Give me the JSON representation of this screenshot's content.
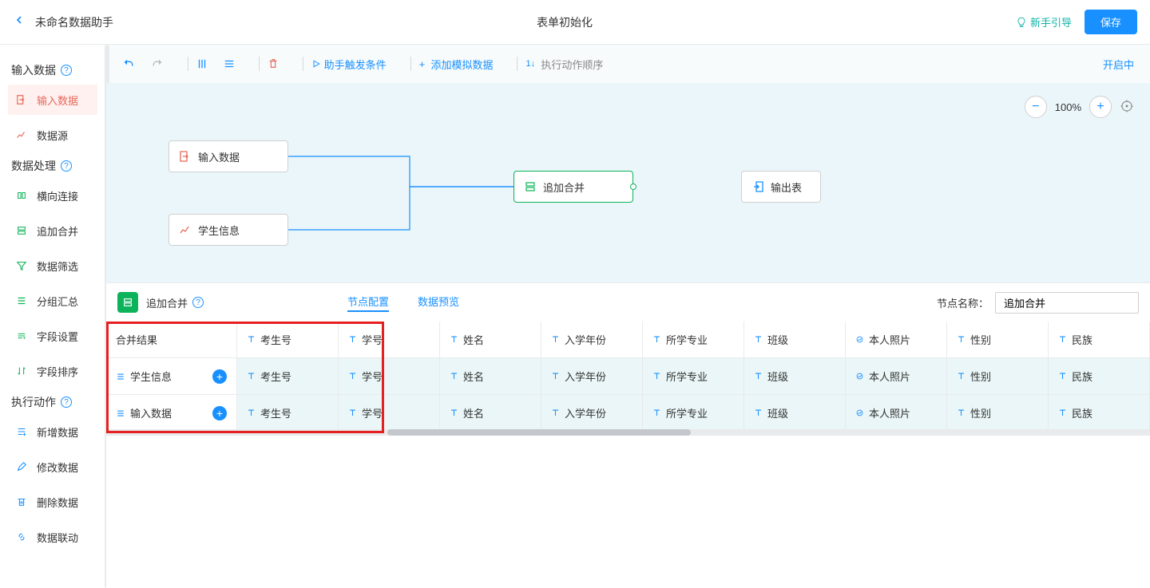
{
  "header": {
    "title_left": "未命名数据助手",
    "title_center": "表单初始化",
    "guide": "新手引导",
    "save": "保存"
  },
  "sidebar": {
    "sections": {
      "input": {
        "title": "输入数据",
        "items": [
          {
            "label": "输入数据",
            "color": "#e8695a"
          },
          {
            "label": "数据源",
            "color": "#e8695a"
          }
        ]
      },
      "process": {
        "title": "数据处理",
        "items": [
          {
            "label": "横向连接",
            "color": "#0db35a"
          },
          {
            "label": "追加合并",
            "color": "#0db35a"
          },
          {
            "label": "数据筛选",
            "color": "#0db35a"
          },
          {
            "label": "分组汇总",
            "color": "#0db35a"
          },
          {
            "label": "字段设置",
            "color": "#0db35a"
          },
          {
            "label": "字段排序",
            "color": "#0db35a"
          }
        ]
      },
      "action": {
        "title": "执行动作",
        "items": [
          {
            "label": "新增数据",
            "color": "#1890ff"
          },
          {
            "label": "修改数据",
            "color": "#1890ff"
          },
          {
            "label": "删除数据",
            "color": "#1890ff"
          },
          {
            "label": "数据联动",
            "color": "#1890ff"
          }
        ]
      }
    }
  },
  "toolbar": {
    "trigger": "助手触发条件",
    "add_mock": "添加模拟数据",
    "exec_order": "执行动作顺序",
    "status": "开启中"
  },
  "zoom": "100%",
  "nodes": {
    "n1": "输入数据",
    "n2": "学生信息",
    "n3": "追加合并",
    "n4": "输出表"
  },
  "panel": {
    "name": "追加合并",
    "tabs": {
      "config": "节点配置",
      "preview": "数据预览"
    },
    "name_label": "节点名称：",
    "name_value": "追加合并"
  },
  "table": {
    "first_header": "合并结果",
    "columns": [
      "考生号",
      "学号",
      "姓名",
      "入学年份",
      "所学专业",
      "班级",
      "本人照片",
      "性别",
      "民族"
    ],
    "rows": [
      {
        "label": "学生信息",
        "cells": [
          "考生号",
          "学号",
          "姓名",
          "入学年份",
          "所学专业",
          "班级",
          "本人照片",
          "性别",
          "民族"
        ]
      },
      {
        "label": "输入数据",
        "cells": [
          "考生号",
          "学号",
          "姓名",
          "入学年份",
          "所学专业",
          "班级",
          "本人照片",
          "性别",
          "民族"
        ]
      }
    ]
  }
}
